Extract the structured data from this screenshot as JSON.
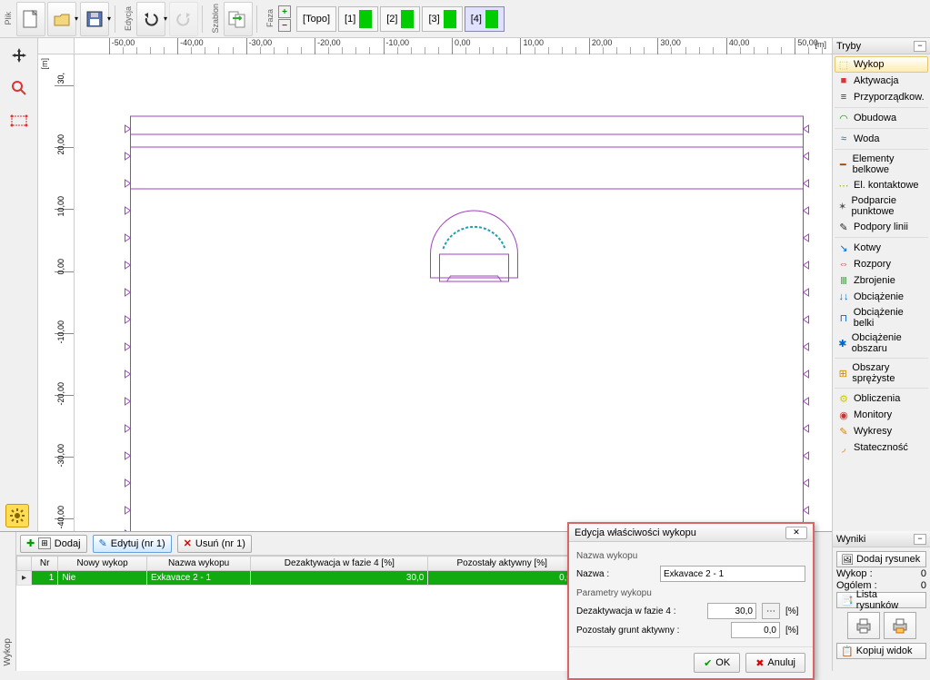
{
  "toolbar": {
    "file_label": "Plik",
    "edit_label": "Edycja",
    "template_label": "Szablon",
    "phase_label": "Faza",
    "phases": [
      "[Topo]",
      "[1]",
      "[2]",
      "[3]",
      "[4]"
    ],
    "active_phase_index": 4
  },
  "ruler": {
    "x_ticks": [
      -50,
      -40,
      -30,
      -20,
      -10,
      0,
      10,
      20,
      30,
      40,
      50
    ],
    "x_labels": [
      "-50,00",
      "-40,00",
      "-30,00",
      "-20,00",
      "-10,00",
      "0,00",
      "10,00",
      "20,00",
      "30,00",
      "40,00",
      "50,00"
    ],
    "y_ticks": [
      30,
      20,
      10,
      0,
      -10,
      -20,
      -30,
      -40
    ],
    "y_labels": [
      "30,",
      "20,00",
      "10,00",
      "0,00",
      "-10,00",
      "-20,00",
      "-30,00",
      "-40,00"
    ],
    "x_unit": "[m]",
    "y_unit": "[m]"
  },
  "modes_panel": {
    "title": "Tryby",
    "items": [
      {
        "label": "Wykop",
        "icon": "⬚",
        "color": "#a2d149",
        "active": true
      },
      {
        "label": "Aktywacja",
        "icon": "■",
        "color": "#d33"
      },
      {
        "label": "Przyporządkow.",
        "icon": "≡",
        "color": "#333"
      },
      {
        "sep": true
      },
      {
        "label": "Obudowa",
        "icon": "◠",
        "color": "#0a0"
      },
      {
        "sep": true
      },
      {
        "label": "Woda",
        "icon": "≈",
        "color": "#06c"
      },
      {
        "sep": true
      },
      {
        "label": "Elementy belkowe",
        "icon": "━",
        "color": "#940"
      },
      {
        "label": "El. kontaktowe",
        "icon": "⋯",
        "color": "#aa0"
      },
      {
        "label": "Podparcie punktowe",
        "icon": "✶",
        "color": "#555"
      },
      {
        "label": "Podpory linii",
        "icon": "✎",
        "color": "#222"
      },
      {
        "sep": true
      },
      {
        "label": "Kotwy",
        "icon": "↘",
        "color": "#06c"
      },
      {
        "label": "Rozpory",
        "icon": "⇔",
        "color": "#c33"
      },
      {
        "label": "Zbrojenie",
        "icon": "Ⅲ",
        "color": "#393"
      },
      {
        "label": "Obciążenie",
        "icon": "↓↓",
        "color": "#06c"
      },
      {
        "label": "Obciążenie belki",
        "icon": "⊓",
        "color": "#06c"
      },
      {
        "label": "Obciążenie obszaru",
        "icon": "✱",
        "color": "#06c"
      },
      {
        "sep": true
      },
      {
        "label": "Obszary sprężyste",
        "icon": "⊞",
        "color": "#c80"
      },
      {
        "sep": true
      },
      {
        "label": "Obliczenia",
        "icon": "⚙",
        "color": "#cc0"
      },
      {
        "label": "Monitory",
        "icon": "◉",
        "color": "#c33"
      },
      {
        "label": "Wykresy",
        "icon": "✎",
        "color": "#c80"
      },
      {
        "label": "Stateczność",
        "icon": "◞",
        "color": "#d70"
      }
    ]
  },
  "table": {
    "toolbar": {
      "add": "Dodaj",
      "edit": "Edytuj (nr 1)",
      "delete": "Usuń (nr 1)"
    },
    "columns": [
      "Nr",
      "Nowy wykop",
      "Nazwa wykopu",
      "Dezaktywacja w fazie 4 [%]",
      "Pozostały aktywny [%]"
    ],
    "rows": [
      {
        "nr": "1",
        "nowy": "Nie",
        "nazwa": "Exkavace 2 - 1",
        "deakt": "30,0",
        "pozost": "0,0",
        "selected": true
      }
    ],
    "side_label": "Wykop"
  },
  "dialog": {
    "title": "Edycja właściwości wykopu",
    "group1": "Nazwa wykopu",
    "name_label": "Nazwa :",
    "name_value": "Exkavace 2 - 1",
    "group2": "Parametry wykopu",
    "deact_label": "Dezaktywacja w fazie 4 :",
    "deact_value": "30,0",
    "deact_unit": "[%]",
    "remain_label": "Pozostały grunt aktywny :",
    "remain_value": "0,0",
    "remain_unit": "[%]",
    "ok": "OK",
    "cancel": "Anuluj"
  },
  "results": {
    "title": "Wyniki",
    "add_drawing": "Dodaj rysunek",
    "row1_label": "Wykop :",
    "row1_val": "0",
    "row2_label": "Ogólem :",
    "row2_val": "0",
    "drawings_list": "Lista rysunków",
    "copy_view": "Kopiuj widok"
  }
}
